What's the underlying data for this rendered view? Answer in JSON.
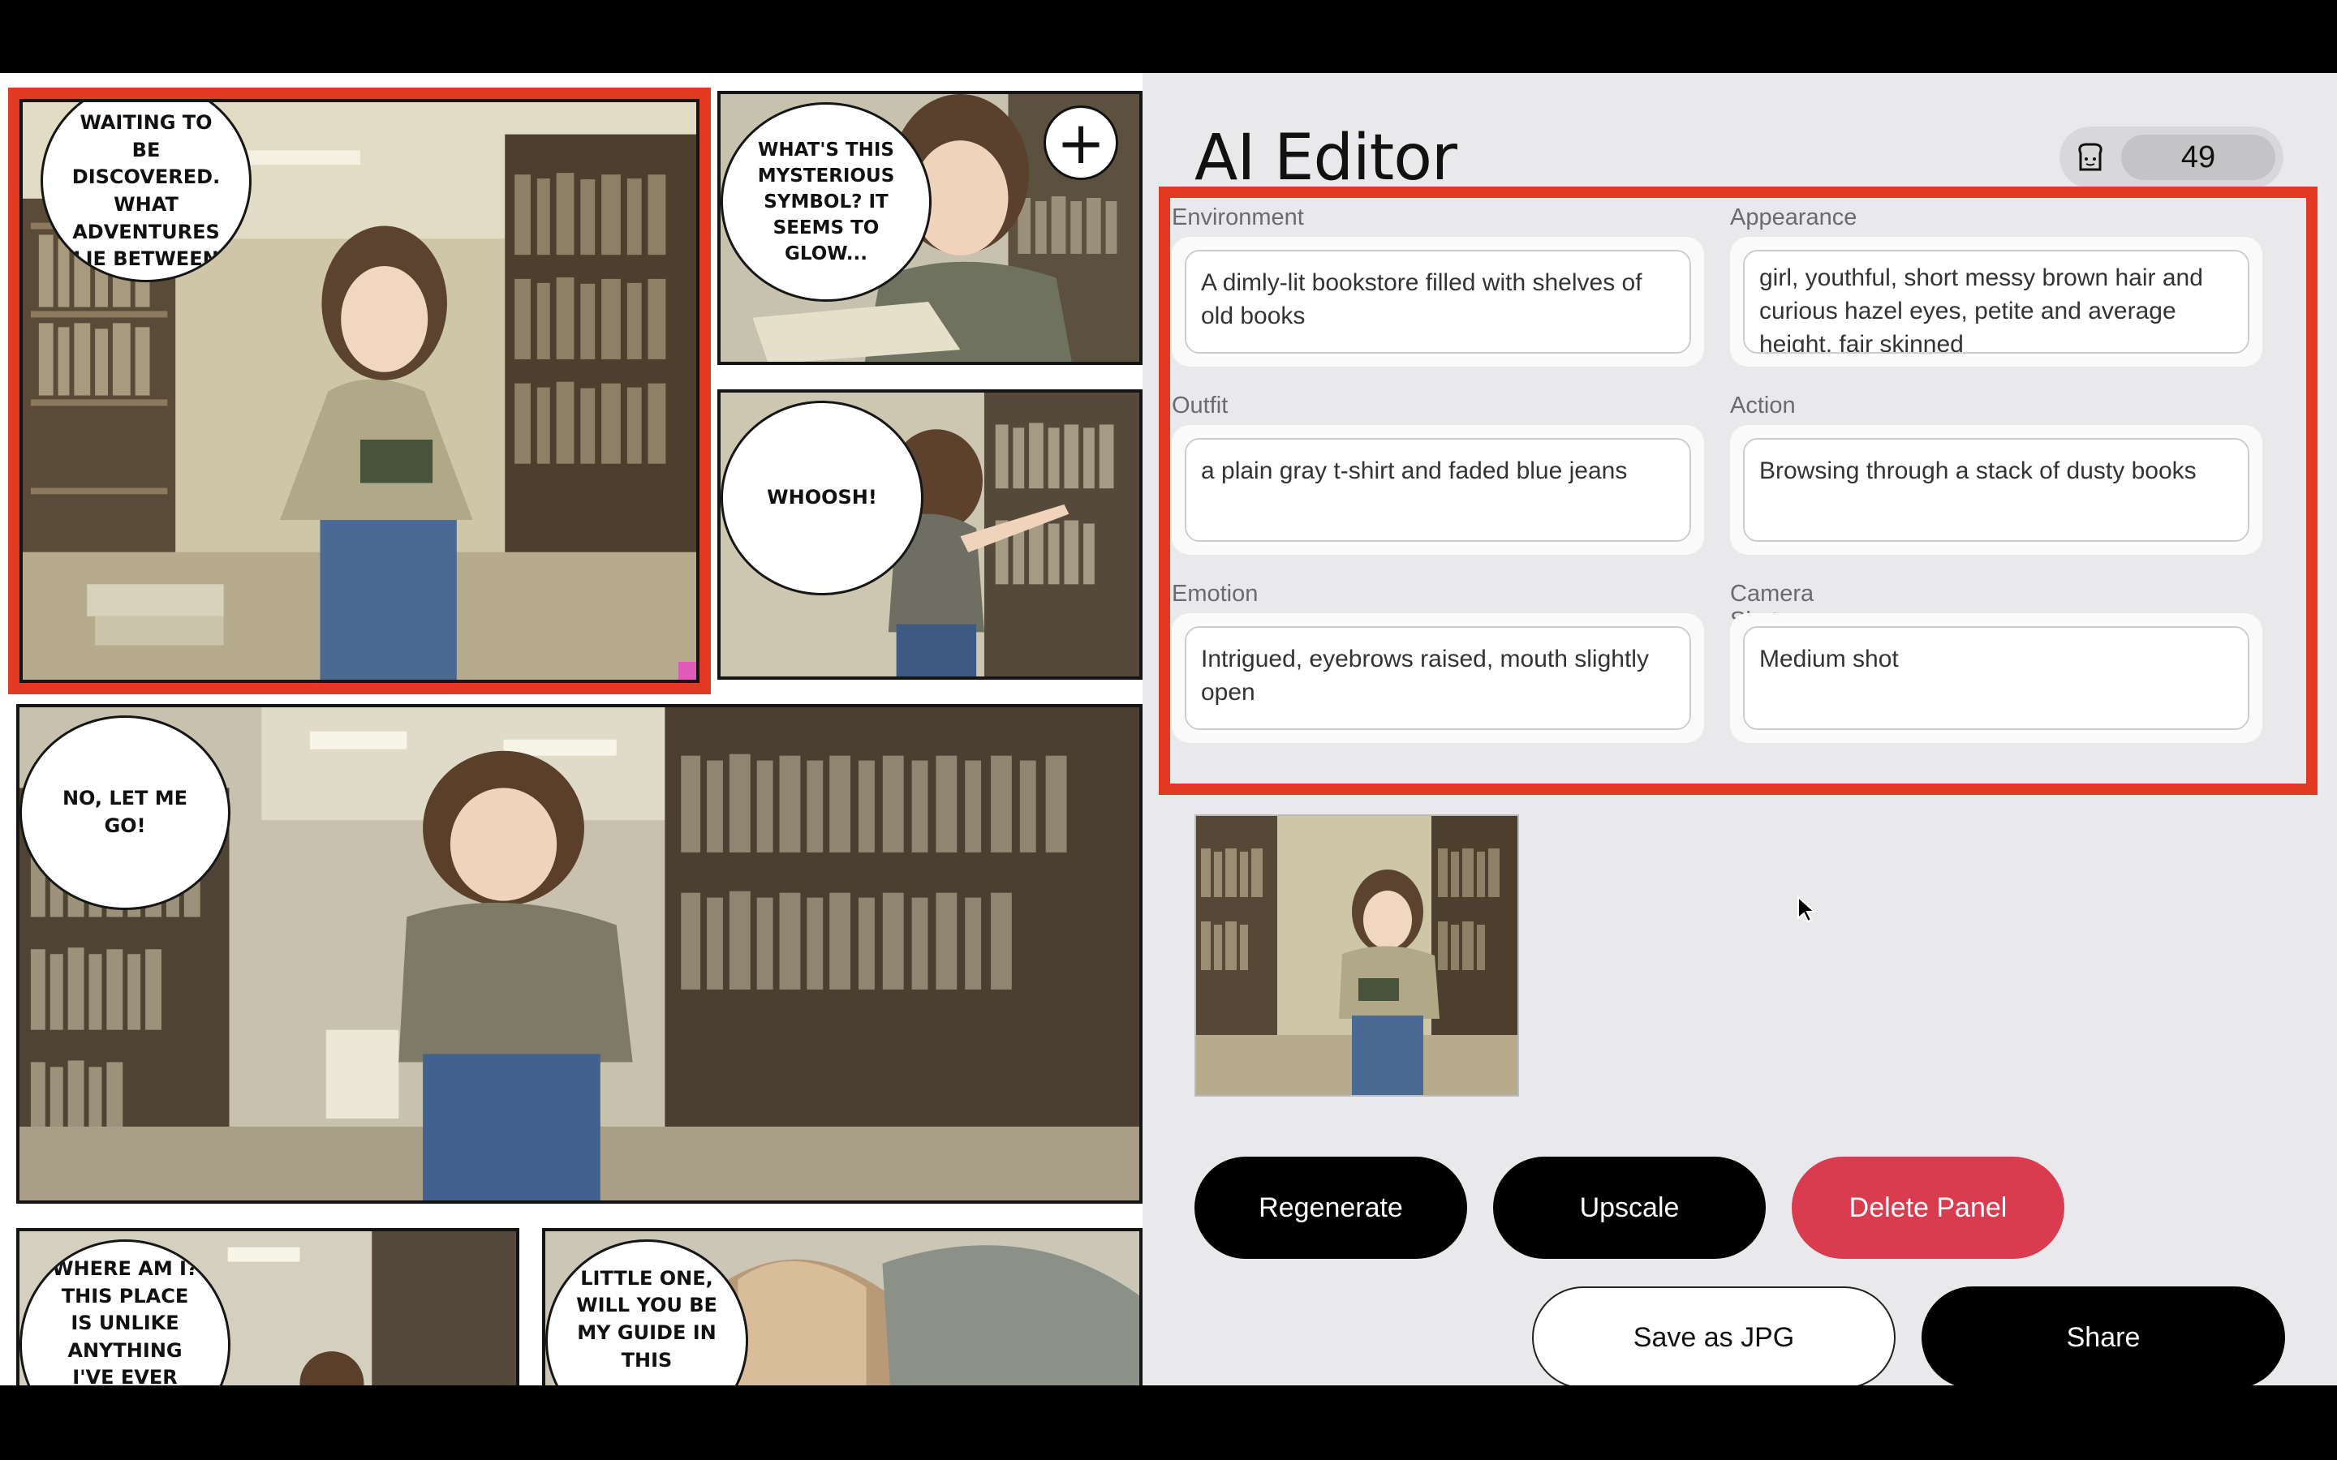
{
  "comic": {
    "panels": [
      {
        "name": "panel-1",
        "selected": true,
        "bubble": "WAITING TO BE DISCOVERED. WHAT ADVENTURES LIE BETWEEN"
      },
      {
        "name": "panel-2",
        "bubble": "WHAT'S THIS MYSTERIOUS SYMBOL? IT SEEMS TO GLOW..."
      },
      {
        "name": "panel-3",
        "bubble": "WHOOSH!"
      },
      {
        "name": "panel-4",
        "bubble": "NO, LET ME GO!"
      },
      {
        "name": "panel-5",
        "bubble": "WHERE AM I? THIS PLACE IS UNLIKE ANYTHING I'VE EVER"
      },
      {
        "name": "panel-6",
        "bubble": "LITTLE ONE, WILL YOU BE MY GUIDE IN THIS"
      }
    ],
    "add_label": "+"
  },
  "editor": {
    "title": "AI Editor",
    "credits": 49,
    "fields": {
      "environment": {
        "label": "Environment",
        "value": "A dimly-lit bookstore filled with shelves of old books"
      },
      "appearance": {
        "label": "Appearance",
        "value": "girl, youthful, short messy brown hair and curious hazel eyes, petite and average height, fair skinned"
      },
      "outfit": {
        "label": "Outfit",
        "value": "a plain gray t-shirt and faded blue jeans"
      },
      "action": {
        "label": "Action",
        "value": "Browsing through a stack of dusty books"
      },
      "emotion": {
        "label": "Emotion",
        "value": "Intrigued, eyebrows raised, mouth slightly open"
      },
      "camera": {
        "label": "Camera Shot",
        "value": "Medium shot"
      }
    },
    "buttons": {
      "regenerate": "Regenerate",
      "upscale": "Upscale",
      "delete": "Delete Panel",
      "save": "Save as JPG",
      "share": "Share"
    }
  },
  "colors": {
    "highlight": "#e23a22",
    "danger": "#d83c4e",
    "primary": "#000000",
    "background": "#e9e8ea"
  }
}
